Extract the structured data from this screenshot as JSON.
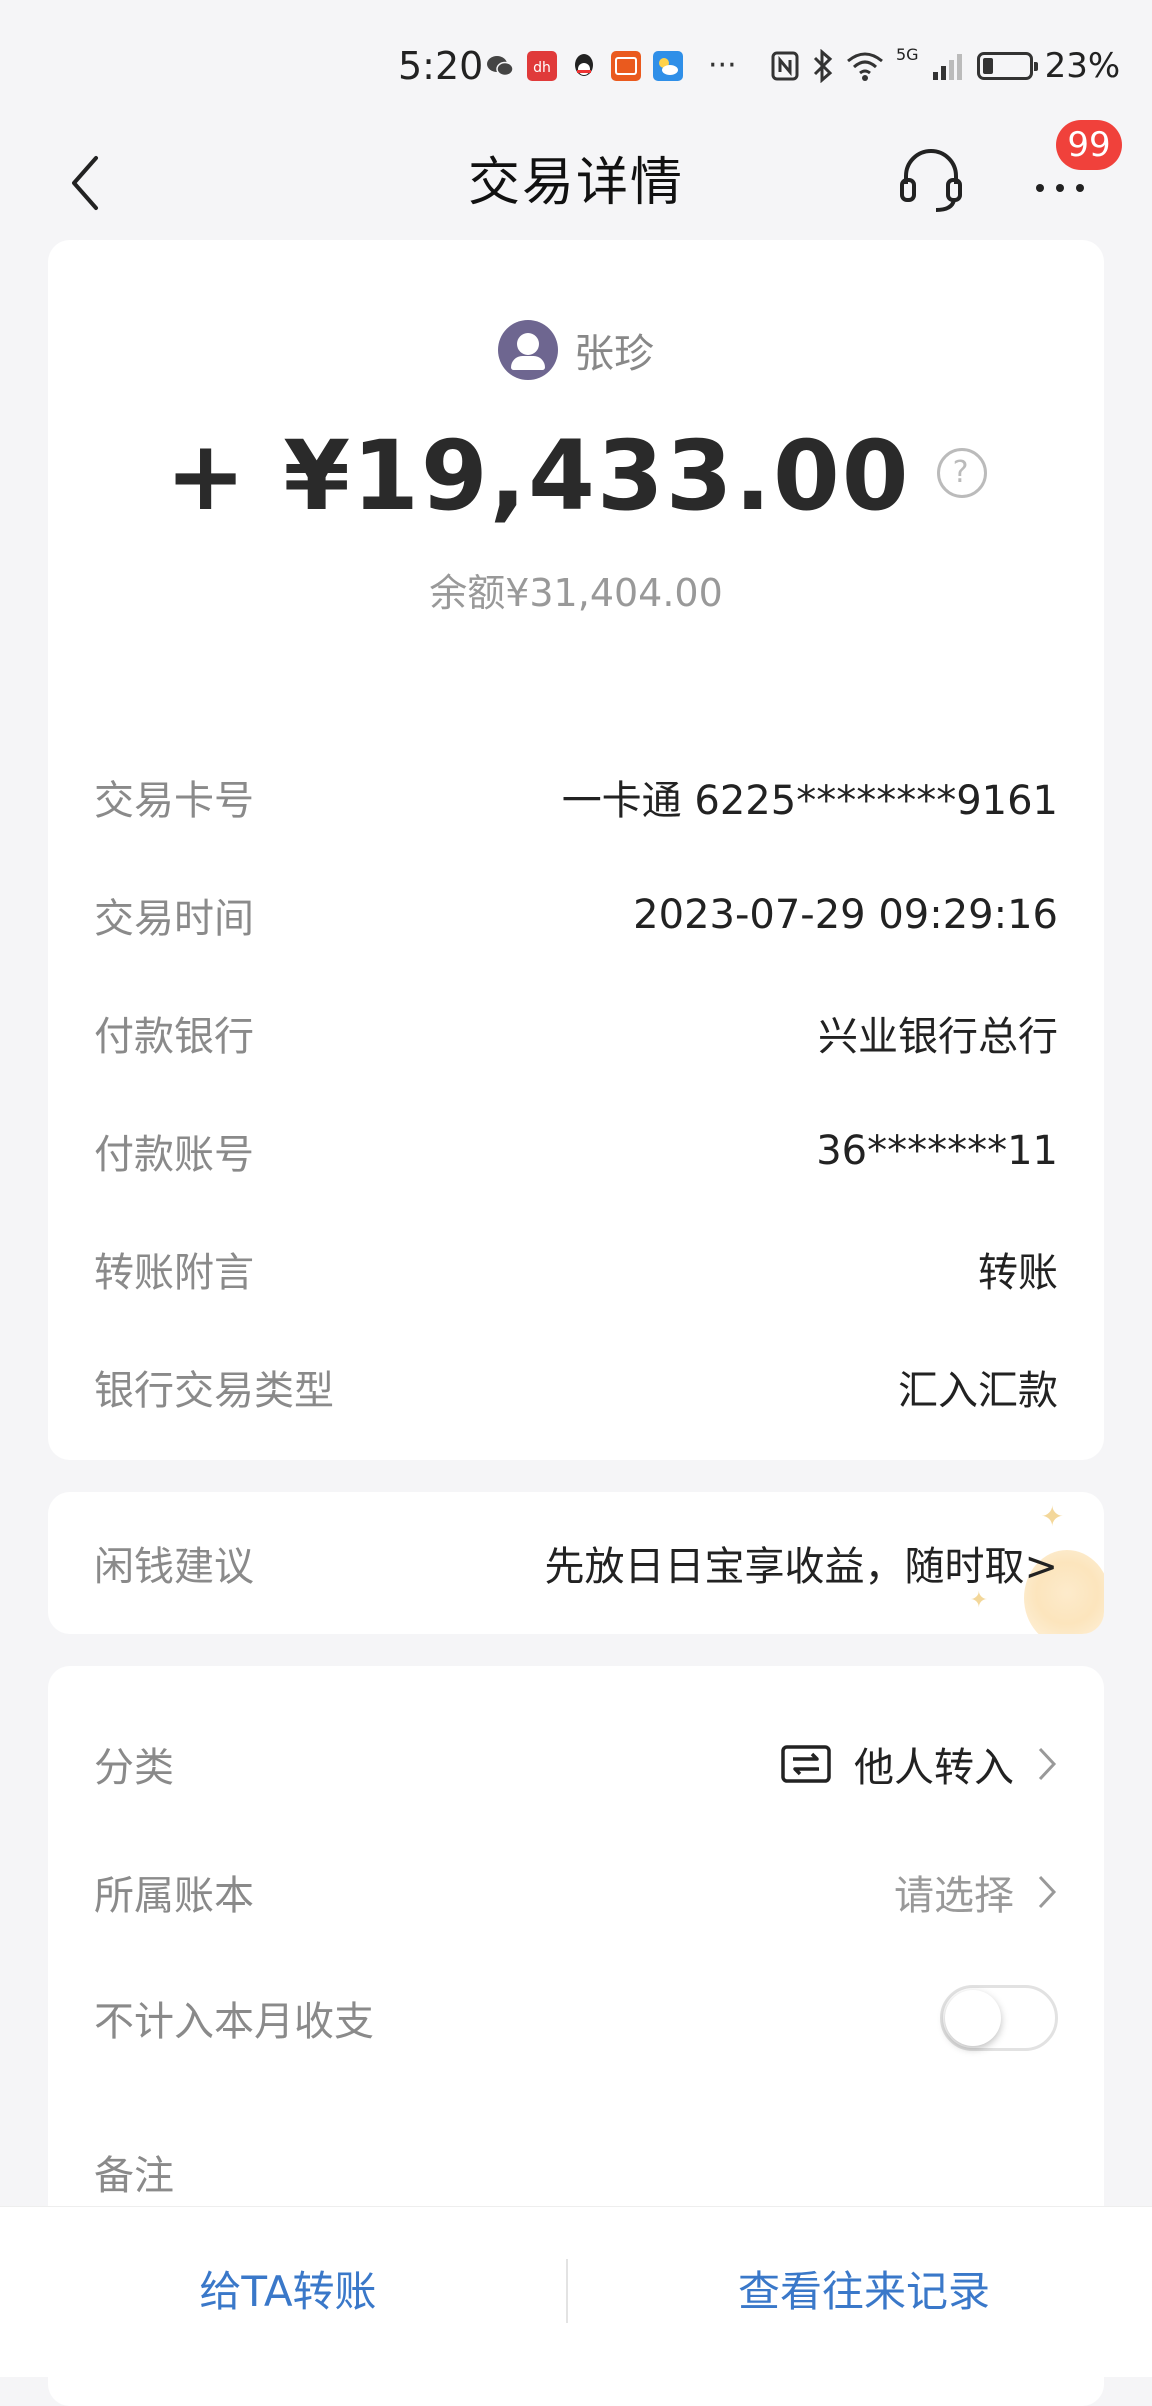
{
  "status_bar": {
    "time": "5:20",
    "more": "···",
    "network": "5G",
    "battery_percent": "23%",
    "battery_level": 0.23,
    "app_icons": [
      "wechat-icon",
      "app-red-icon",
      "qq-icon",
      "bank-app-icon",
      "weather-icon"
    ]
  },
  "nav": {
    "title": "交易详情",
    "badge": "99"
  },
  "transaction": {
    "payer_name": "张珍",
    "amount": "+ ¥19,433.00",
    "help": "?",
    "balance": "余额¥31,404.00"
  },
  "details": [
    {
      "label": "交易卡号",
      "value": "一卡通 6225********9161"
    },
    {
      "label": "交易时间",
      "value": "2023-07-29 09:29:16"
    },
    {
      "label": "付款银行",
      "value": "兴业银行总行"
    },
    {
      "label": "付款账号",
      "value": "36*******11"
    },
    {
      "label": "转账附言",
      "value": "转账"
    },
    {
      "label": "银行交易类型",
      "value": "汇入汇款"
    }
  ],
  "idle_money": {
    "label": "闲钱建议",
    "value": "先放日日宝享收益，随时取>"
  },
  "settings": {
    "category_label": "分类",
    "category_value": "他人转入",
    "ledger_label": "所属账本",
    "ledger_value": "请选择",
    "exclude_label": "不计入本月收支",
    "exclude_on": false,
    "note_label": "备注"
  },
  "bottom": {
    "transfer": "给TA转账",
    "history": "查看往来记录"
  },
  "colors": {
    "accent_blue": "#3a78c9",
    "badge_red": "#f0413b",
    "label_gray": "#8a8a8a"
  }
}
